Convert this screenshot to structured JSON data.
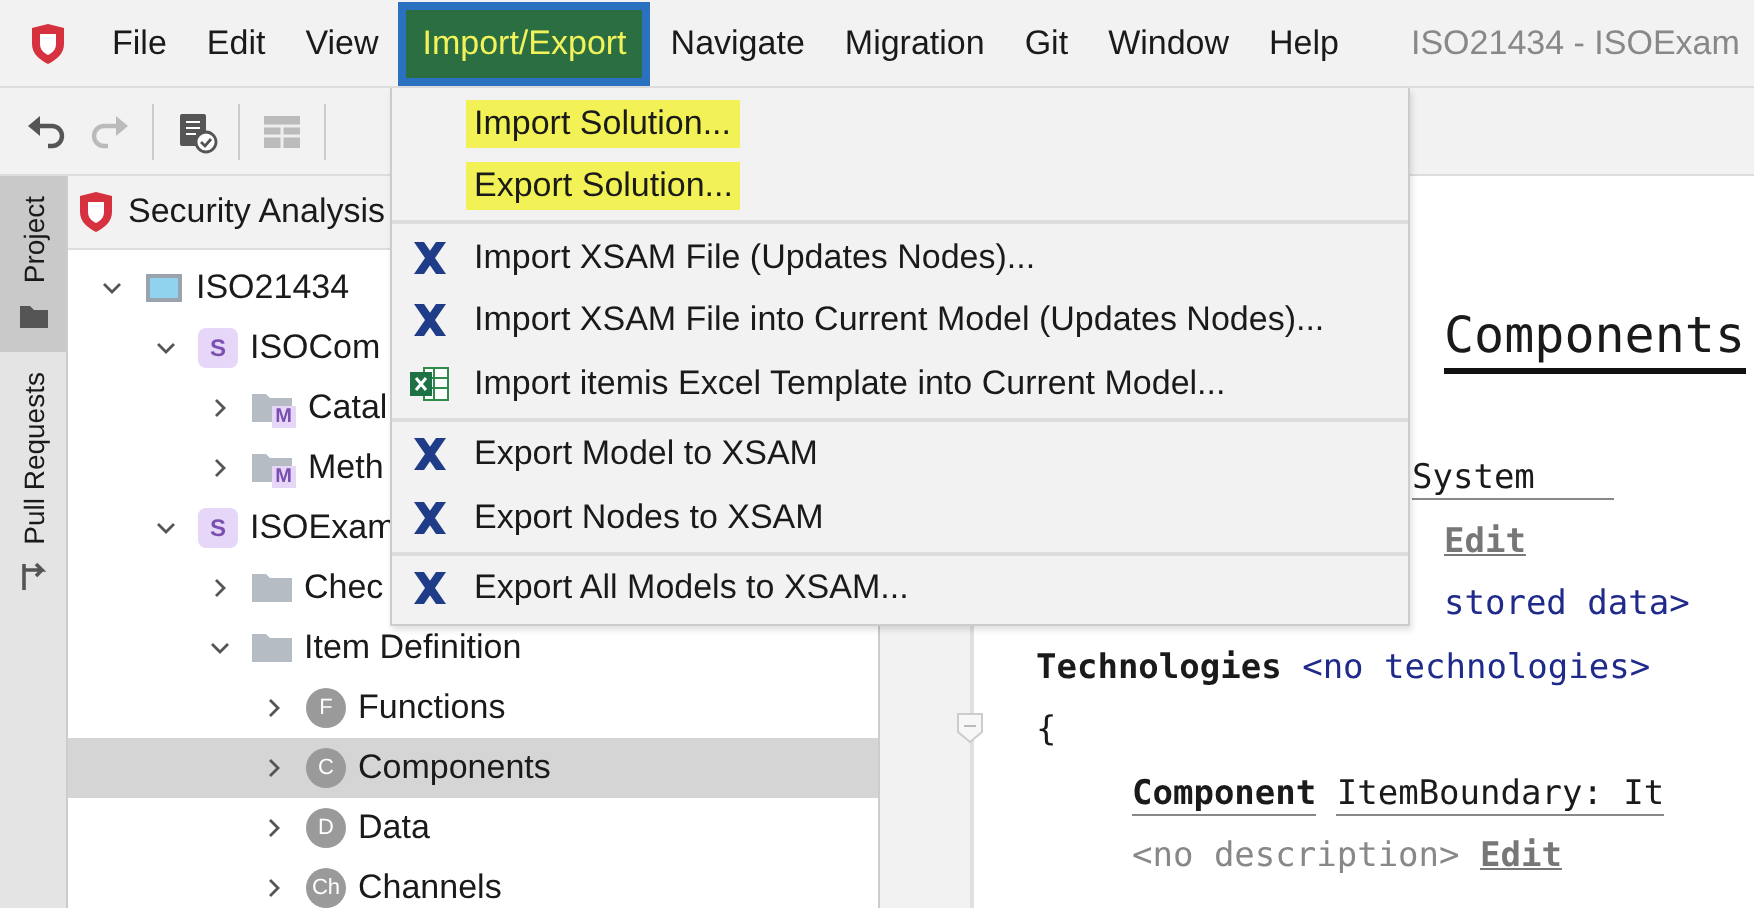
{
  "menubar": {
    "items": [
      {
        "label": "File",
        "selected": false
      },
      {
        "label": "Edit",
        "selected": false
      },
      {
        "label": "View",
        "selected": false
      },
      {
        "label": "Import/Export",
        "selected": true
      },
      {
        "label": "Navigate",
        "selected": false
      },
      {
        "label": "Migration",
        "selected": false
      },
      {
        "label": "Git",
        "selected": false
      },
      {
        "label": "Window",
        "selected": false
      },
      {
        "label": "Help",
        "selected": false
      }
    ],
    "window_title": "ISO21434 - ISOExam"
  },
  "side_tabs": [
    {
      "label": "Project",
      "selected": true
    },
    {
      "label": "Pull Requests",
      "selected": false
    }
  ],
  "project_panel": {
    "title": "Security Analysis",
    "tree": [
      {
        "label": "ISO21434",
        "kind": "model",
        "expanded": true,
        "selected": false,
        "children": [
          {
            "label": "ISOCom",
            "kind": "solution",
            "badge": "S",
            "expanded": true,
            "selected": false,
            "children": [
              {
                "label": "Catal",
                "kind": "module",
                "badge": "M",
                "expanded": false,
                "selected": false
              },
              {
                "label": "Meth",
                "kind": "module",
                "badge": "M",
                "expanded": false,
                "selected": false
              }
            ]
          },
          {
            "label": "ISOExam",
            "kind": "solution",
            "badge": "S",
            "expanded": true,
            "selected": false,
            "children": [
              {
                "label": "Chec",
                "kind": "folder",
                "expanded": false,
                "selected": false
              },
              {
                "label": "Item Definition",
                "kind": "folder",
                "expanded": true,
                "selected": false,
                "children": [
                  {
                    "label": "Functions",
                    "kind": "concept",
                    "badge": "F",
                    "expanded": false,
                    "selected": false
                  },
                  {
                    "label": "Components",
                    "kind": "concept",
                    "badge": "C",
                    "expanded": false,
                    "selected": true
                  },
                  {
                    "label": "Data",
                    "kind": "concept",
                    "badge": "D",
                    "expanded": false,
                    "selected": false
                  },
                  {
                    "label": "Channels",
                    "kind": "concept",
                    "badge": "Ch",
                    "expanded": false,
                    "selected": false
                  }
                ]
              }
            ]
          }
        ]
      }
    ]
  },
  "editor": {
    "heading": "Components",
    "system": "System",
    "edit_link": "Edit",
    "stored_data": "stored data>",
    "technologies": {
      "keyword": "Technologies",
      "value": "<no technologies>"
    },
    "brace": "{",
    "component": {
      "keyword": "Component",
      "name": "ItemBoundary: It"
    },
    "description": {
      "placeholder": "<no description>",
      "link": "Edit"
    }
  },
  "menu": {
    "groups": [
      [
        {
          "label": "Import Solution...",
          "kind": "plain",
          "highlighted": true
        },
        {
          "label": "Export Solution...",
          "kind": "plain",
          "highlighted": true
        }
      ],
      [
        {
          "label": "Import XSAM File (Updates Nodes)...",
          "kind": "xsam",
          "highlighted": false
        },
        {
          "label": "Import XSAM File into Current Model (Updates Nodes)...",
          "kind": "xsam",
          "highlighted": false
        },
        {
          "label": "Import itemis Excel Template into Current Model...",
          "kind": "excel",
          "highlighted": false
        }
      ],
      [
        {
          "label": "Export Model to XSAM",
          "kind": "xsam",
          "highlighted": false
        },
        {
          "label": "Export Nodes to XSAM",
          "kind": "xsam",
          "highlighted": false
        }
      ],
      [
        {
          "label": "Export All Models to XSAM...",
          "kind": "xsam",
          "highlighted": false
        }
      ]
    ]
  }
}
